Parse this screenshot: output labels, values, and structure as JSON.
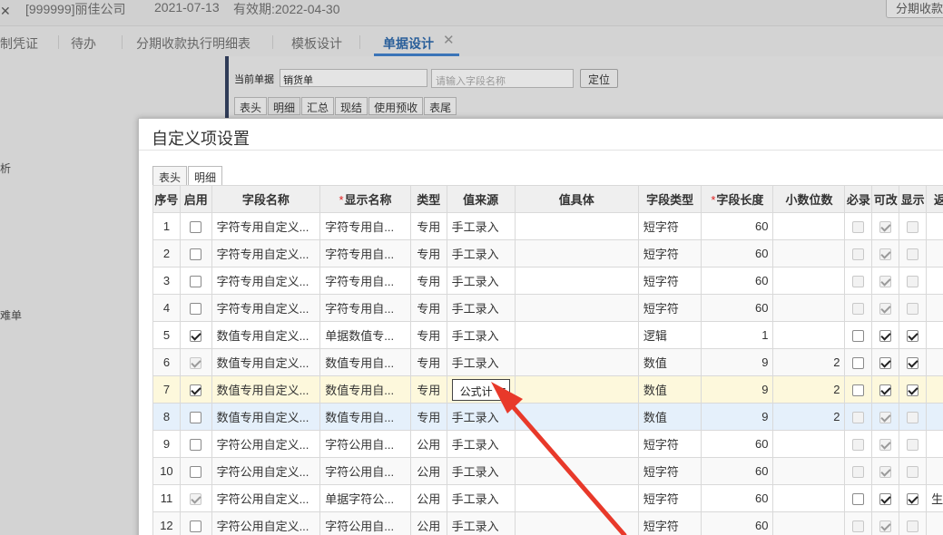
{
  "topbar": {
    "logo": "✕",
    "company": "[999999]丽佳公司",
    "date": "2021-07-13",
    "valid": "有效期:2022-04-30",
    "right_button": "分期收款"
  },
  "tabs": [
    {
      "label": "制凭证"
    },
    {
      "label": "待办"
    },
    {
      "label": "分期收款执行明细表"
    },
    {
      "label": "模板设计"
    },
    {
      "label": "单据设计"
    }
  ],
  "tab_close": "✕",
  "sidebar": {
    "items": [
      {
        "label": "析"
      },
      {
        "label": "难单"
      }
    ]
  },
  "designer": {
    "current_label": "当前单据",
    "current_value": "销货单",
    "search_placeholder": "请输入字段名称",
    "locate_button": "定位",
    "tabs": [
      "表头",
      "明细",
      "汇总",
      "现结",
      "使用预收",
      "表尾"
    ]
  },
  "modal": {
    "title": "自定义项设置",
    "tabs": [
      "表头",
      "明细"
    ],
    "columns": [
      "序号",
      "启用",
      "字段名称",
      "显示名称",
      "类型",
      "值来源",
      "值具体",
      "字段类型",
      "字段长度",
      "小数位数",
      "必录",
      "可改",
      "显示",
      "返"
    ],
    "required_marker": "*",
    "rows": [
      {
        "no": "1",
        "enabled": false,
        "enabled_dis": false,
        "field": "字符专用自定义...",
        "display": "字符专用自...",
        "type": "专用",
        "source": "手工录入",
        "detail": "",
        "ftype": "短字符",
        "len": "60",
        "dec": "",
        "req": false,
        "req_dis": true,
        "edit": true,
        "edit_dis": true,
        "show": false,
        "show_dis": true,
        "last": ""
      },
      {
        "no": "2",
        "enabled": false,
        "enabled_dis": false,
        "field": "字符专用自定义...",
        "display": "字符专用自...",
        "type": "专用",
        "source": "手工录入",
        "detail": "",
        "ftype": "短字符",
        "len": "60",
        "dec": "",
        "req": false,
        "req_dis": true,
        "edit": true,
        "edit_dis": true,
        "show": false,
        "show_dis": true,
        "last": ""
      },
      {
        "no": "3",
        "enabled": false,
        "enabled_dis": false,
        "field": "字符专用自定义...",
        "display": "字符专用自...",
        "type": "专用",
        "source": "手工录入",
        "detail": "",
        "ftype": "短字符",
        "len": "60",
        "dec": "",
        "req": false,
        "req_dis": true,
        "edit": true,
        "edit_dis": true,
        "show": false,
        "show_dis": true,
        "last": ""
      },
      {
        "no": "4",
        "enabled": false,
        "enabled_dis": false,
        "field": "字符专用自定义...",
        "display": "字符专用自...",
        "type": "专用",
        "source": "手工录入",
        "detail": "",
        "ftype": "短字符",
        "len": "60",
        "dec": "",
        "req": false,
        "req_dis": true,
        "edit": true,
        "edit_dis": true,
        "show": false,
        "show_dis": true,
        "last": ""
      },
      {
        "no": "5",
        "enabled": true,
        "enabled_dis": false,
        "field": "数值专用自定义...",
        "display": "单据数值专...",
        "type": "专用",
        "source": "手工录入",
        "detail": "",
        "ftype": "逻辑",
        "len": "1",
        "dec": "",
        "req": false,
        "req_dis": false,
        "edit": true,
        "edit_dis": false,
        "show": true,
        "show_dis": false,
        "last": ""
      },
      {
        "no": "6",
        "enabled": true,
        "enabled_dis": true,
        "field": "数值专用自定义...",
        "display": "数值专用自...",
        "type": "专用",
        "source": "手工录入",
        "detail": "",
        "ftype": "数值",
        "len": "9",
        "dec": "2",
        "req": false,
        "req_dis": false,
        "edit": true,
        "edit_dis": false,
        "show": true,
        "show_dis": false,
        "last": ""
      },
      {
        "no": "7",
        "enabled": true,
        "enabled_dis": false,
        "field": "数值专用自定义...",
        "display": "数值专用自...",
        "type": "专用",
        "source": "公式计",
        "source_combo": true,
        "detail": "",
        "ftype": "数值",
        "len": "9",
        "dec": "2",
        "req": false,
        "req_dis": false,
        "edit": true,
        "edit_dis": false,
        "show": true,
        "show_dis": false,
        "last": ""
      },
      {
        "no": "8",
        "enabled": false,
        "enabled_dis": false,
        "field": "数值专用自定义...",
        "display": "数值专用自...",
        "type": "专用",
        "source": "手工录入",
        "detail": "",
        "ftype": "数值",
        "len": "9",
        "dec": "2",
        "req": false,
        "req_dis": true,
        "edit": true,
        "edit_dis": true,
        "show": false,
        "show_dis": true,
        "last": ""
      },
      {
        "no": "9",
        "enabled": false,
        "enabled_dis": false,
        "field": "字符公用自定义...",
        "display": "字符公用自...",
        "type": "公用",
        "source": "手工录入",
        "detail": "",
        "ftype": "短字符",
        "len": "60",
        "dec": "",
        "req": false,
        "req_dis": true,
        "edit": true,
        "edit_dis": true,
        "show": false,
        "show_dis": true,
        "last": ""
      },
      {
        "no": "10",
        "enabled": false,
        "enabled_dis": false,
        "field": "字符公用自定义...",
        "display": "字符公用自...",
        "type": "公用",
        "source": "手工录入",
        "detail": "",
        "ftype": "短字符",
        "len": "60",
        "dec": "",
        "req": false,
        "req_dis": true,
        "edit": true,
        "edit_dis": true,
        "show": false,
        "show_dis": true,
        "last": ""
      },
      {
        "no": "11",
        "enabled": true,
        "enabled_dis": true,
        "field": "字符公用自定义...",
        "display": "单据字符公...",
        "type": "公用",
        "source": "手工录入",
        "detail": "",
        "ftype": "短字符",
        "len": "60",
        "dec": "",
        "req": false,
        "req_dis": false,
        "edit": true,
        "edit_dis": false,
        "show": true,
        "show_dis": false,
        "last": "生"
      },
      {
        "no": "12",
        "enabled": false,
        "enabled_dis": false,
        "field": "字符公用自定义...",
        "display": "字符公用自...",
        "type": "公用",
        "source": "手工录入",
        "detail": "",
        "ftype": "短字符",
        "len": "60",
        "dec": "",
        "req": false,
        "req_dis": true,
        "edit": true,
        "edit_dis": true,
        "show": false,
        "show_dis": true,
        "last": ""
      }
    ]
  },
  "colors": {
    "arrow": "#e8392a",
    "active_tab": "#2a5f9a",
    "highlight_row": "#fdf8dc",
    "hover_row": "#e5f0fb"
  }
}
